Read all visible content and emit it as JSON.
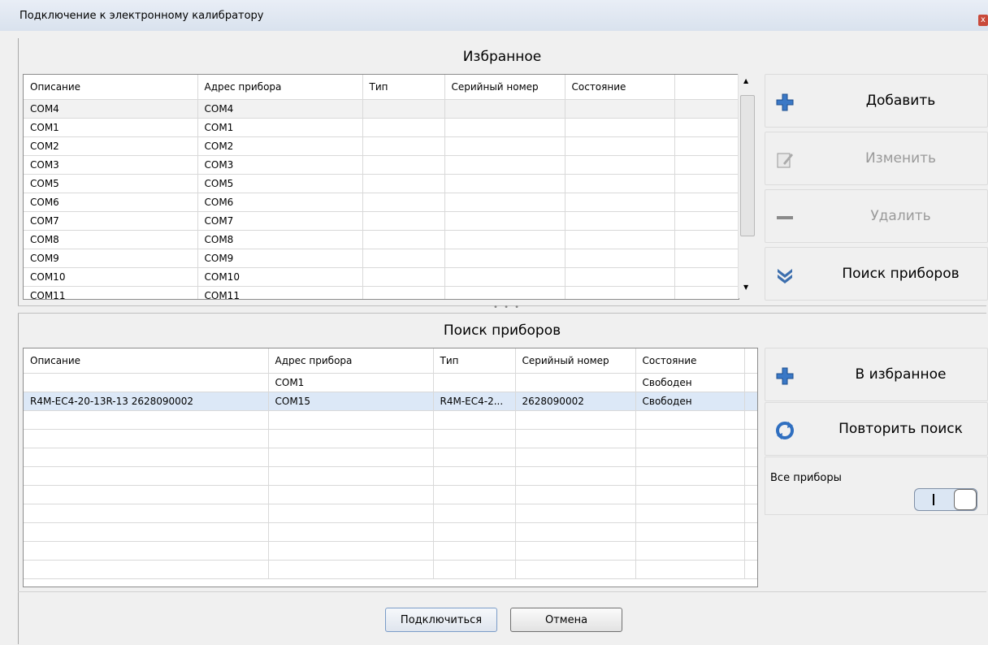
{
  "window": {
    "title": "Подключение к электронному калибратору"
  },
  "favorites": {
    "title": "Избранное",
    "columns": [
      "Описание",
      "Адрес прибора",
      "Тип",
      "Серийный номер",
      "Состояние"
    ],
    "rows": [
      [
        "COM4",
        "COM4",
        "",
        "",
        ""
      ],
      [
        "COM1",
        "COM1",
        "",
        "",
        ""
      ],
      [
        "COM2",
        "COM2",
        "",
        "",
        ""
      ],
      [
        "COM3",
        "COM3",
        "",
        "",
        ""
      ],
      [
        "COM5",
        "COM5",
        "",
        "",
        ""
      ],
      [
        "COM6",
        "COM6",
        "",
        "",
        ""
      ],
      [
        "COM7",
        "COM7",
        "",
        "",
        ""
      ],
      [
        "COM8",
        "COM8",
        "",
        "",
        ""
      ],
      [
        "COM9",
        "COM9",
        "",
        "",
        ""
      ],
      [
        "COM10",
        "COM10",
        "",
        "",
        ""
      ],
      [
        "COM11",
        "COM11",
        "",
        "",
        ""
      ]
    ],
    "buttons": {
      "add": "Добавить",
      "edit": "Изменить",
      "delete": "Удалить",
      "search": "Поиск приборов"
    }
  },
  "search": {
    "title": "Поиск приборов",
    "columns": [
      "Описание",
      "Адрес прибора",
      "Тип",
      "Серийный номер",
      "Состояние"
    ],
    "rows": [
      [
        "",
        "COM1",
        "",
        "",
        "Свободен"
      ],
      [
        "R4M-EC4-20-13R-13 2628090002",
        "COM15",
        "R4M-EC4-2...",
        "2628090002",
        "Свободен"
      ]
    ],
    "buttons": {
      "to_favorites": "В избранное",
      "repeat": "Повторить поиск"
    },
    "all_devices": {
      "label": "Все приборы",
      "on": true
    }
  },
  "footer": {
    "connect": "Подключиться",
    "cancel": "Отмена"
  },
  "colors": {
    "accent_blue": "#2f6fc0",
    "selection_blue": "#dce8f7"
  }
}
